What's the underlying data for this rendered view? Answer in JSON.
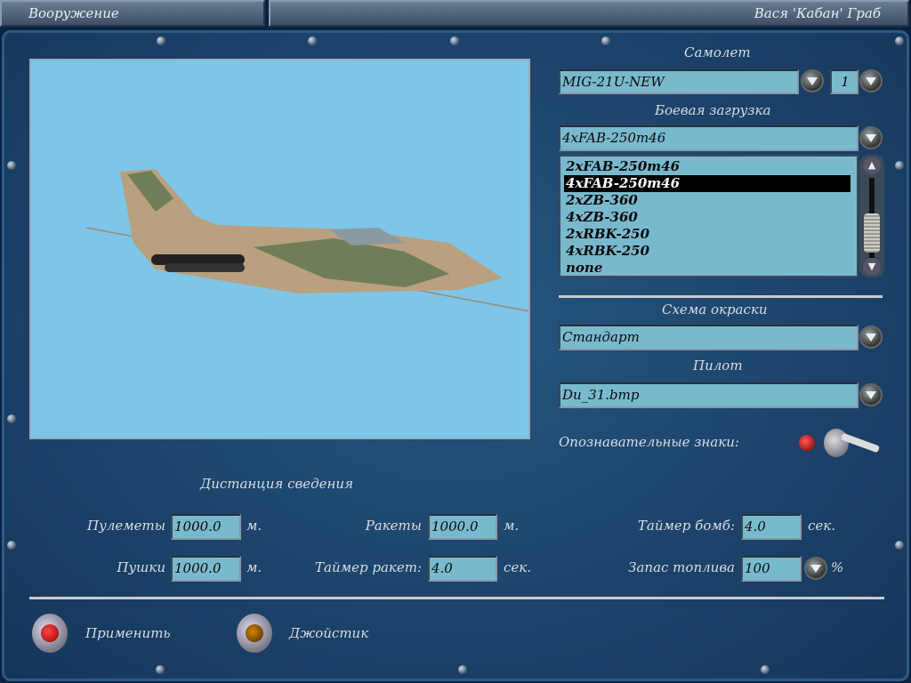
{
  "header": {
    "title": "Вооружение",
    "player": "Вася 'Кабан' Граб"
  },
  "aircraft": {
    "label": "Самолет",
    "value": "MIG-21U-NEW",
    "count": "1"
  },
  "loadout": {
    "label": "Боевая загрузка",
    "value": "4xFAB-250m46",
    "options": [
      "2xFAB-250m46",
      "4xFAB-250m46",
      "2xZB-360",
      "4xZB-360",
      "2xRBK-250",
      "4xRBK-250",
      "none"
    ],
    "selected_index": 1
  },
  "paint": {
    "label": "Схема окраски",
    "value": "Стандарт"
  },
  "pilot": {
    "label": "Пилот",
    "value": "Du_31.bmp"
  },
  "markings": {
    "label": "Опознавательные знаки:"
  },
  "convergence": {
    "title": "Дистанция сведения",
    "mg_label": "Пулеметы",
    "mg_value": "1000.0",
    "mg_unit": "м.",
    "cannon_label": "Пушки",
    "cannon_value": "1000.0",
    "cannon_unit": "м.",
    "rocket_label": "Ракеты",
    "rocket_value": "1000.0",
    "rocket_unit": "м.",
    "rocket_timer_label": "Таймер ракет:",
    "rocket_timer_value": "4.0",
    "rocket_timer_unit": "сек.",
    "bomb_timer_label": "Таймер бомб:",
    "bomb_timer_value": "4.0",
    "bomb_timer_unit": "сек.",
    "fuel_label": "Запас топлива",
    "fuel_value": "100",
    "fuel_unit": "%"
  },
  "actions": {
    "apply": "Применить",
    "joystick": "Джойстик"
  }
}
